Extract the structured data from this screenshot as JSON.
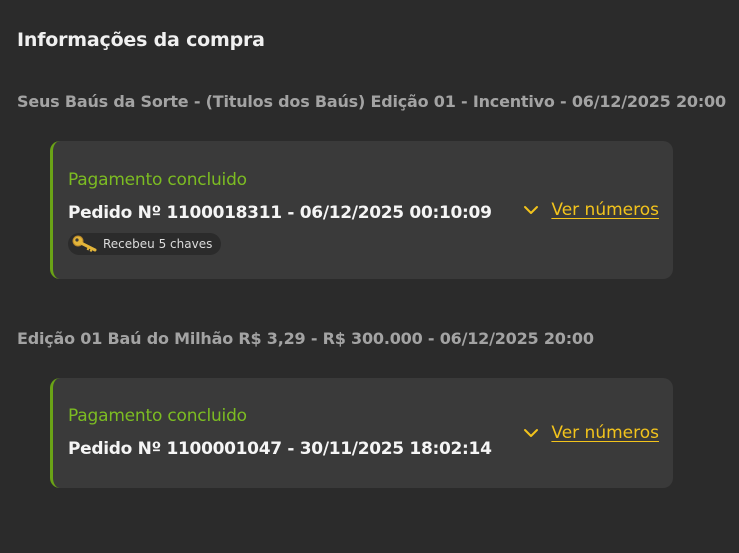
{
  "page": {
    "title": "Informações da compra"
  },
  "groups": [
    {
      "title": "Seus Baús da Sorte - (Titulos dos Baús) Edição 01 - Incentivo - 06/12/2025 20:00",
      "card": {
        "status": "Pagamento concluido",
        "order": "Pedido Nº 1100018311 - 06/12/2025 00:10:09",
        "reward": "Recebeu 5 chaves",
        "reward_icon": "key-icon",
        "toggle_label": "Ver números",
        "toggle_icon": "chevron-down-icon"
      }
    },
    {
      "title": "Edição 01 Baú do Milhão R$ 3,29 - R$ 300.000 - 06/12/2025 20:00",
      "card": {
        "status": "Pagamento concluido",
        "order": "Pedido Nº 1100001047 - 30/11/2025 18:02:14",
        "toggle_label": "Ver números",
        "toggle_icon": "chevron-down-icon"
      }
    }
  ],
  "colors": {
    "background": "#2b2b2b",
    "card": "#3a3a3a",
    "success": "#7cbc22",
    "accent_link": "#f2c31c",
    "muted_text": "#a3a3a3"
  }
}
